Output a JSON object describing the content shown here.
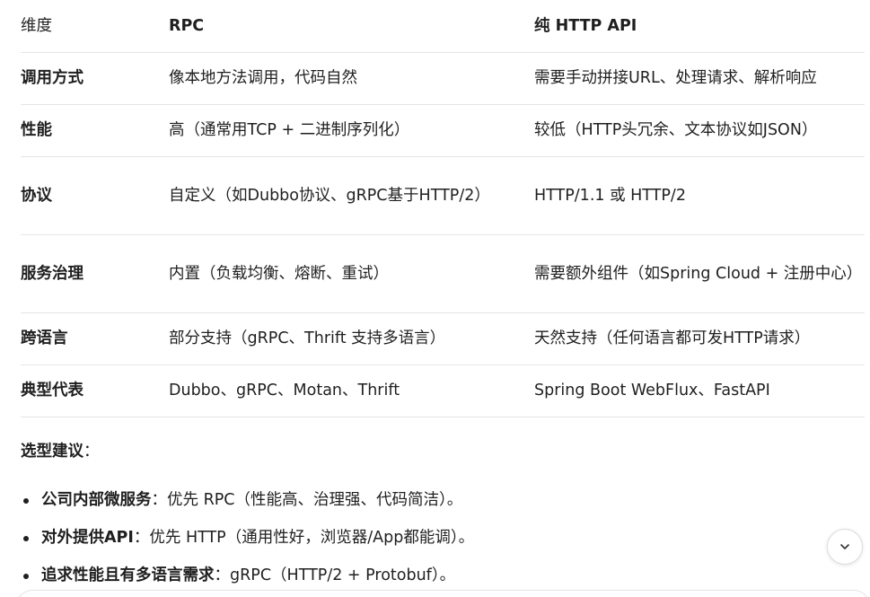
{
  "table": {
    "headers": [
      "维度",
      "RPC",
      "纯 HTTP API"
    ],
    "rows": [
      [
        "调用方式",
        "像本地方法调用，代码自然",
        "需要手动拼接URL、处理请求、解析响应"
      ],
      [
        "性能",
        "高（通常用TCP + 二进制序列化）",
        "较低（HTTP头冗余、文本协议如JSON）"
      ],
      [
        "协议",
        "自定义（如Dubbo协议、gRPC基于HTTP/2）",
        "HTTP/1.1 或 HTTP/2"
      ],
      [
        "服务治理",
        "内置（负载均衡、熔断、重试）",
        "需要额外组件（如Spring Cloud + 注册中心）"
      ],
      [
        "跨语言",
        "部分支持（gRPC、Thrift 支持多语言）",
        "天然支持（任何语言都可发HTTP请求）"
      ],
      [
        "典型代表",
        "Dubbo、gRPC、Motan、Thrift",
        "Spring Boot WebFlux、FastAPI"
      ]
    ]
  },
  "advice": {
    "title": "选型建议",
    "title_suffix": "：",
    "items": [
      {
        "label": "公司内部微服务",
        "sep": "：",
        "text": "优先 RPC（性能高、治理强、代码简洁）。"
      },
      {
        "label": "对外提供API",
        "sep": "：",
        "text": "优先 HTTP（通用性好，浏览器/App都能调）。"
      },
      {
        "label": "追求性能且有多语言需求",
        "sep": "：",
        "text": "gRPC（HTTP/2 + Protobuf）。"
      }
    ]
  },
  "icons": {
    "scroll_down": "chevron-down-icon"
  }
}
